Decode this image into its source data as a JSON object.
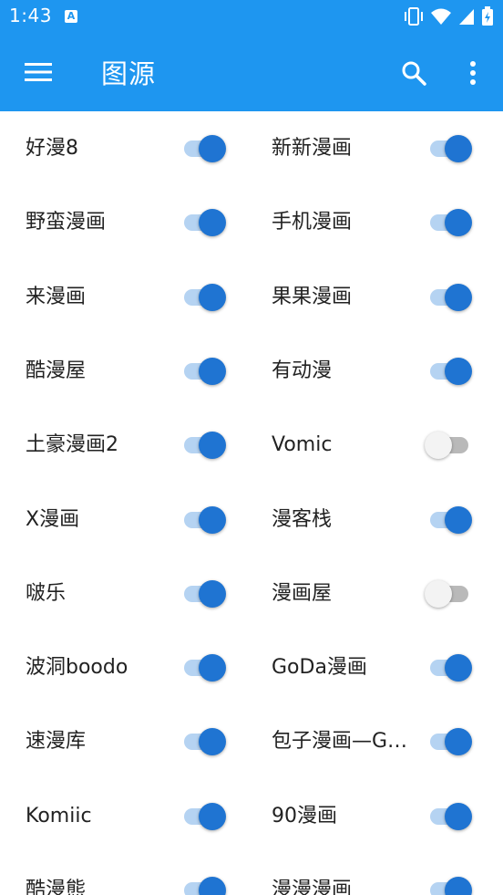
{
  "status": {
    "time": "1:43",
    "notification_letter": "A"
  },
  "appbar": {
    "title": "图源"
  },
  "colors": {
    "primary": "#1e96f0",
    "switch_on_thumb": "#1f74d2",
    "switch_on_track": "#b5d3f2",
    "switch_off_thumb": "#f3f3f3",
    "switch_off_track": "#b9b9b9"
  },
  "sources": [
    {
      "label": "好漫8",
      "enabled": true
    },
    {
      "label": "新新漫画",
      "enabled": true
    },
    {
      "label": "野蛮漫画",
      "enabled": true
    },
    {
      "label": "手机漫画",
      "enabled": true
    },
    {
      "label": "来漫画",
      "enabled": true
    },
    {
      "label": "果果漫画",
      "enabled": true
    },
    {
      "label": "酷漫屋",
      "enabled": true
    },
    {
      "label": "有动漫",
      "enabled": true
    },
    {
      "label": "土豪漫画2",
      "enabled": true
    },
    {
      "label": "Vomic",
      "enabled": false
    },
    {
      "label": "X漫画",
      "enabled": true
    },
    {
      "label": "漫客栈",
      "enabled": true
    },
    {
      "label": "啵乐",
      "enabled": true
    },
    {
      "label": "漫画屋",
      "enabled": false
    },
    {
      "label": "波洞boodo",
      "enabled": true
    },
    {
      "label": "GoDa漫画",
      "enabled": true
    },
    {
      "label": "速漫库",
      "enabled": true
    },
    {
      "label": "包子漫画—G…",
      "enabled": true
    },
    {
      "label": "Komiic",
      "enabled": true
    },
    {
      "label": "90漫画",
      "enabled": true
    },
    {
      "label": "酷漫熊",
      "enabled": true
    },
    {
      "label": "漫漫漫画",
      "enabled": true
    }
  ]
}
